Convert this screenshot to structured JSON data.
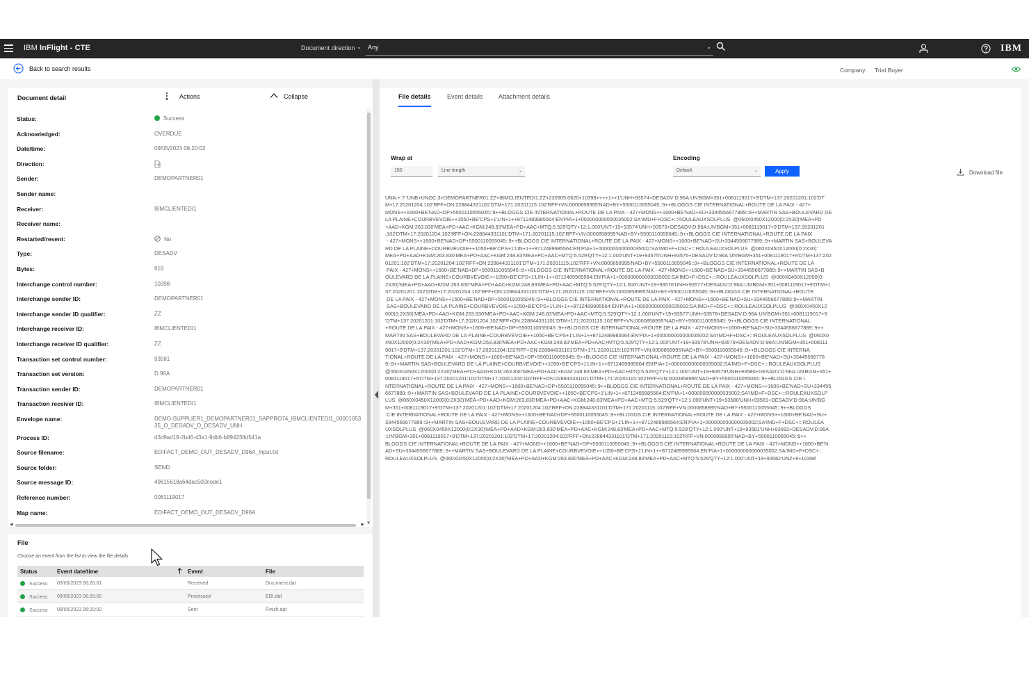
{
  "topbar": {
    "app_prefix": "IBM",
    "app_name": "InFlight - CTE",
    "direction_label": "Document direction",
    "direction_value": "Any"
  },
  "subbar": {
    "back_label": "Back to search results",
    "company_label": "Company:",
    "company_value": "Trial Buyer"
  },
  "detail": {
    "title": "Document detail",
    "actions_label": "Actions",
    "collapse_label": "Collapse",
    "fields": [
      {
        "label": "Status:",
        "value": "Success"
      },
      {
        "label": "Acknowledged:",
        "value": "OVERDUE"
      },
      {
        "label": "Date/time:",
        "value": "09/05/2023 06:20:02"
      },
      {
        "label": "Direction:",
        "value": ""
      },
      {
        "label": "Sender:",
        "value": "DEMOPARTNER01"
      },
      {
        "label": "Sender name:",
        "value": ""
      },
      {
        "label": "Receiver:",
        "value": "IBMCLIENTEDI1"
      },
      {
        "label": "Receiver name:",
        "value": ""
      },
      {
        "label": "Restarted/resent:",
        "value": "No"
      },
      {
        "label": "Type:",
        "value": "DESADV"
      },
      {
        "label": "Bytes:",
        "value": "616"
      },
      {
        "label": "Interchange control number:",
        "value": "10398"
      },
      {
        "label": "Interchange sender ID:",
        "value": "DEMOPARTNER01"
      },
      {
        "label": "Interchange sender ID qualifier:",
        "value": "ZZ"
      },
      {
        "label": "Interchange receiver ID:",
        "value": "IBMCLIENTEDI1"
      },
      {
        "label": "Interchange receiver ID qualifier:",
        "value": "ZZ"
      },
      {
        "label": "Transaction set control number:",
        "value": "93581"
      },
      {
        "label": "Transaction set version:",
        "value": "D.96A"
      },
      {
        "label": "Transaction sender ID:",
        "value": "DEMOPARTNER01"
      },
      {
        "label": "Transaction receiver ID:",
        "value": "IBMCLIENTEDI1"
      },
      {
        "label": "Envelope name:",
        "value": "DEMO-SUPPLIER1_DEMOPARTNER01_SAPPRO74_IBMCLIENTEDI1_0000105335_O_DESADV_D_DESADV_UNH"
      },
      {
        "label": "Process ID:",
        "value": "d3d9ad18-2bd6-43a1-9db6-b894238d541a"
      },
      {
        "label": "Source filename:",
        "value": "EDIFACT_DEMO_OUT_DESADV_D96A_Input.txt"
      },
      {
        "label": "Source folder:",
        "value": "SEND"
      },
      {
        "label": "Source message ID:",
        "value": "49615618a64dac500node1"
      },
      {
        "label": "Reference number:",
        "value": "0081119017"
      },
      {
        "label": "Map name:",
        "value": "EDIFACT_DEMO_OUT_DESADV_D96A"
      }
    ]
  },
  "file_section": {
    "title": "File",
    "hint": "Choose an event from the list to view the file details.",
    "columns": [
      "Status",
      "Event date/time",
      "Event",
      "File"
    ],
    "rows": [
      {
        "status": "Success",
        "datetime": "09/05/2023 06:20:01",
        "event": "Received",
        "file": "Document.dat"
      },
      {
        "status": "Success",
        "datetime": "09/05/2023 06:20:02",
        "event": "Processed",
        "file": "EDI.dat"
      },
      {
        "status": "Success",
        "datetime": "09/05/2023 06:20:02",
        "event": "Sent",
        "file": "Finish.dat"
      }
    ]
  },
  "right": {
    "tabs": [
      "File details",
      "Event details",
      "Attachment details"
    ],
    "wrap_label": "Wrap at",
    "wrap_value": "150",
    "wrap_mode": "Line length",
    "encoding_label": "Encoding",
    "encoding_value": "Default",
    "apply_label": "Apply",
    "download_label": "Download file",
    "edi_lines": [
      "UNA:+.? 'UNB+UNOC:3+DEMOPARTNER01:ZZ+IBMCLIENTEDI1:ZZ+230905:0620+10398++++1++1'UNH+93574+DESADV:D:96A:UN'BGM+351+0081119017+9'DTM+137:20201201:102'DT",
      "M+17:20201204:102'RFF+ON:228844331101'DTM+171:20201115:102'RFF+VN:0000858995'NAD+BY+5500110055045::9++BLOGGS CIE INTERNATIONAL+ROUTE DE LA PAIX - 427+",
      "MONS++1600+BE'NAD+DP+5500110055045::9++BLOGGS CIE INTERNATIONAL+ROUTE DE LA PAIX - 427+MONS++1600+BE'NAD+SU+3344556677889::9++MARTIN SAS+BOULEVARD DE",
      "LA PLAINE+COURBVEVOIE++1050+BE'CPS+1'LIN+1++8712489985564:EN'PIA+1+000000000000035002:SA'IMD+F+DSC+:::ROULEAUXSOLPLUS  @060X0450X12000(0:2X30)'MEA+PD",
      "+AAD+KGM:263.830'MEA+PD+AAC+KGM:248.83'MEA+PD+AAC+MTQ:5.529'QTY+12:1.000'UNT+19+93574'UNH+93575+DESADV:D:96A:UN'BGM+351+0081119017+9'DTM+137:20201201",
      ":102'DTM+17:20201204:102'RFF+ON:228844331101'DTM+171:20201115:102'RFF+VN:0000858995'NAD+BY+5500110055045::9++BLOGGS CIE INTERNATIONAL+ROUTE DE LA PAIX",
      " - 427+MONS++1600+BE'NAD+DP+5500110055045::9++BLOGGS CIE INTERNATIONAL+ROUTE DE LA PAIX - 427+MONS++1600+BE'NAD+SU+3344556677889::9++MARTIN SAS+BOULEVA",
      "RD DE LA PLAINE+COURBVEVOIE++1050+BE'CPS+1'LIN+1++8712489985564:EN'PIA+1+000000000000035002:SA'IMD+F+DSC+:::ROULEAUXSOLPLUS  @060X0450X12000(0:2X30)'",
      "MEA+PD+AAD+KGM:263.830'MEA+PD+AAC+KGM:248.83'MEA+PD+AAC+MTQ:5.529'QTY+12:1.000'UNT+19+93575'UNH+93576+DESADV:D:96A:UN'BGM+351+0081119017+9'DTM+137:202",
      "01201:102'DTM+17:20201204:102'RFF+ON:228844331101'DTM+171:20201115:102'RFF+VN:0000858995'NAD+BY+5500110055045::9++BLOGGS CIE INTERNATIONAL+ROUTE DE LA",
      " PAIX - 427+MONS++1600+BE'NAD+DP+5500110055045::9++BLOGGS CIE INTERNATIONAL+ROUTE DE LA PAIX - 427+MONS++1600+BE'NAD+SU+3344556677889::9++MARTIN SAS+B",
      "OULEVARD DE LA PLAINE+COURBVEVOIE++1050+BE'CPS+1'LIN+1++8712489985564:EN'PIA+1+000000000000035002:SA'IMD+F+DSC+:::ROULEAUXSOLPLUS  @060X0450X12000(0:",
      "2X30)'MEA+PD+AAD+KGM:263.830'MEA+PD+AAC+KGM:248.83'MEA+PD+AAC+MTQ:5.529'QTY+12:1.000'UNT+19+93576'UNH+93577+DESADV:D:96A:UN'BGM+351+0081119017+9'DTM+1",
      "37:20201201:102'DTM+17:20201204:102'RFF+ON:228844331101'DTM+171:20201115:102'RFF+VN:0000858995'NAD+BY+5500110055045::9++BLOGGS CIE INTERNATIONAL+ROUTE",
      " DE LA PAIX - 427+MONS++1600+BE'NAD+DP+5500110055045::9++BLOGGS CIE INTERNATIONAL+ROUTE DE LA PAIX - 427+MONS++1600+BE'NAD+SU+3344556677889::9++MARTIN",
      " SAS+BOULEVARD DE LA PLAINE+COURBVEVOIE++1050+BE'CPS+1'LIN+1++8712489985564:EN'PIA+1+000000000000035002:SA'IMD+F+DSC+:::ROULEAUXSOLPLUS  @060X0450X12",
      "000(0:2X30)'MEA+PD+AAD+KGM:263.830'MEA+PD+AAC+KGM:248.83'MEA+PD+AAC+MTQ:5.529'QTY+12:1.000'UNT+19+93577'UNH+93578+DESADV:D:96A:UN'BGM+351+0081119017+9",
      "'DTM+137:20201201:102'DTM+17:20201204:102'RFF+ON:228844331101'DTM+171:20201115:102'RFF+VN:0000858995'NAD+BY+5500110055045::9++BLOGGS CIE INTERNATIONAL",
      "+ROUTE DE LA PAIX - 427+MONS++1600+BE'NAD+DP+5500110055045::9++BLOGGS CIE INTERNATIONAL+ROUTE DE LA PAIX - 427+MONS++1600+BE'NAD+SU+3344556677889::9++",
      "MARTIN SAS+BOULEVARD DE LA PLAINE+COURBVEVOIE++1050+BE'CPS+1'LIN+1++8712489985564:EN'PIA+1+000000000000035002:SA'IMD+F+DSC+:::ROULEAUXSOLPLUS  @060X0",
      "450X12000(0:2X30)'MEA+PD+AAD+KGM:263.830'MEA+PD+AAC+KGM:248.83'MEA+PD+AAC+MTQ:5.529'QTY+12:1.000'UNT+19+93578'UNH+93579+DESADV:D:96A:UN'BGM+351+008111",
      "9017+9'DTM+137:20201201:102'DTM+17:20201204:102'RFF+ON:228844331101'DTM+171:20201115:102'RFF+VN:0000858995'NAD+BY+5500110055045::9++BLOGGS CIE INTERNA",
      "TIONAL+ROUTE DE LA PAIX - 427+MONS++1600+BE'NAD+DP+5500110055045::9++BLOGGS CIE INTERNATIONAL+ROUTE DE LA PAIX - 427+MONS++1600+BE'NAD+SU+33445566778",
      "9::9++MARTIN SAS+BOULEVARD DE LA PLAINE+COURBVEVOIE++1050+BE'CPS+1'LIN+1++8712489985564:EN'PIA+1+000000000000035002:SA'IMD+F+DSC+:::ROULEAUXSOLPLUS",
      "@060X0450X12000(0:2X30)'MEA+PD+AAD+KGM:263.830'MEA+PD+AAC+KGM:248.83'MEA+PD+AAC+MTQ:5.529'QTY+12:1.000'UNT+19+93579'UNH+93580+DESADV:D:96A:UN'BGM+351+",
      "0081119017+9'DTM+137:20201201:102'DTM+17:20201204:102'RFF+ON:228844331101'DTM+171:20201115:102'RFF+VN:0000858995'NAD+BY+5500110055045::9++BLOGGS CIE I",
      "NTERNATIONAL+ROUTE DE LA PAIX - 427+MONS++1600+BE'NAD+DP+5500110055045::9++BLOGGS CIE INTERNATIONAL+ROUTE DE LA PAIX - 427+MONS++1600+BE'NAD+SU+334455",
      "6677889::9++MARTIN SAS+BOULEVARD DE LA PLAINE+COURBVEVOIE++1050+BE'CPS+1'LIN+1++8712489985564:EN'PIA+1+000000000000035002:SA'IMD+F+DSC+:::ROULEAUXSOLP",
      "LUS  @060X0450X12000(0:2X30)'MEA+PD+AAD+KGM:263.830'MEA+PD+AAC+KGM:248.83'MEA+PD+AAC+MTQ:5.529'QTY+12:1.000'UNT+19+93580'UNH+93581+DESADV:D:96A:UN'BG",
      "M+351+0081119017+9'DTM+137:20201201:102'DTM+17:20201204:102'RFF+ON:228844331101'DTM+171:20201115:102'RFF+VN:0000858995'NAD+BY+5500110055045::9++BLOGGS",
      " CIE INTERNATIONAL+ROUTE DE LA PAIX - 427+MONS++1600+BE'NAD+DP+5500110055045::9++BLOGGS CIE INTERNATIONAL+ROUTE DE LA PAIX - 427+MONS++1600+BE'NAD+SU+",
      "3344556677889::9++MARTIN SAS+BOULEVARD DE LA PLAINE+COURBVEVOIE++1050+BE'CPS+1'LIN+1++8712489985564:EN'PIA+1+000000000000035002:SA'IMD+F+DSC+:::ROULEA",
      "UXSOLPLUS  @060X0450X12000(0:2X30)'MEA+PD+AAD+KGM:263.830'MEA+PD+AAC+KGM:248.83'MEA+PD+AAC+MTQ:5.529'QTY+12:1.000'UNT+19+93581'UNH+93582+DESADV:D:96A",
      ":UN'BGM+351+0081119017+9'DTM+137:20201201:102'DTM+17:20201204:102'RFF+ON:228844331101'DTM+171:20201115:102'RFF+VN:0000858995'NAD+BY+5500110055045::9++",
      "BLOGGS CIE INTERNATIONAL+ROUTE DE LA PAIX - 427+MONS++1600+BE'NAD+DP+5500110055045::9++BLOGGS CIE INTERNATIONAL+ROUTE DE LA PAIX - 427+MONS++1600+BE'N",
      "AD+SU+3344556677889::9++MARTIN SAS+BOULEVARD DE LA PLAINE+COURBVEVOIE++1050+BE'CPS+1'LIN+1++8712489985564:EN'PIA+1+000000000000035002:SA'IMD+F+DSC+:::",
      "ROULEAUXSOLPLUS  @060X0450X12000(0:2X30)'MEA+PD+AAD+KGM:263.830'MEA+PD+AAC+KGM:248.83'MEA+PD+AAC+MTQ:5.529'QTY+12:1.000'UNT+19+93582'UNZ+9+10398'"
    ]
  },
  "colors": {
    "topbar": "#262626",
    "accent": "#0f62fe",
    "success": "#24a148"
  }
}
